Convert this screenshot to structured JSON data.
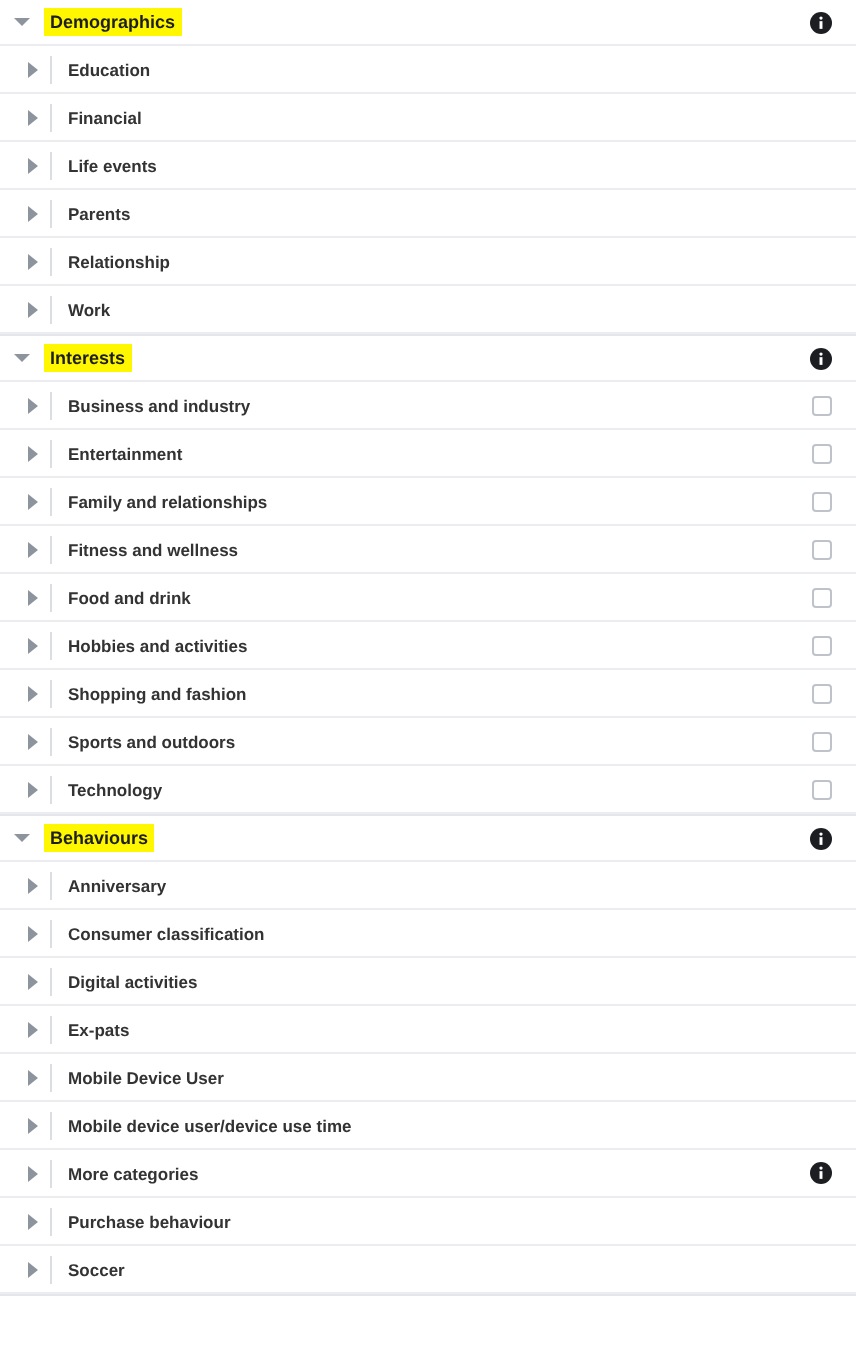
{
  "sections": [
    {
      "title": "Demographics",
      "highlighted": true,
      "items": [
        {
          "label": "Education",
          "kind": "plain"
        },
        {
          "label": "Financial",
          "kind": "plain"
        },
        {
          "label": "Life events",
          "kind": "plain"
        },
        {
          "label": "Parents",
          "kind": "plain"
        },
        {
          "label": "Relationship",
          "kind": "plain"
        },
        {
          "label": "Work",
          "kind": "plain"
        }
      ]
    },
    {
      "title": "Interests",
      "highlighted": true,
      "items": [
        {
          "label": "Business and industry",
          "kind": "checkbox",
          "checked": false
        },
        {
          "label": "Entertainment",
          "kind": "checkbox",
          "checked": false
        },
        {
          "label": "Family and relationships",
          "kind": "checkbox",
          "checked": false
        },
        {
          "label": "Fitness and wellness",
          "kind": "checkbox",
          "checked": false
        },
        {
          "label": "Food and drink",
          "kind": "checkbox",
          "checked": false
        },
        {
          "label": "Hobbies and activities",
          "kind": "checkbox",
          "checked": false
        },
        {
          "label": "Shopping and fashion",
          "kind": "checkbox",
          "checked": false
        },
        {
          "label": "Sports and outdoors",
          "kind": "checkbox",
          "checked": false
        },
        {
          "label": "Technology",
          "kind": "checkbox",
          "checked": false
        }
      ]
    },
    {
      "title": "Behaviours",
      "highlighted": true,
      "items": [
        {
          "label": "Anniversary",
          "kind": "plain"
        },
        {
          "label": "Consumer classification",
          "kind": "plain"
        },
        {
          "label": "Digital activities",
          "kind": "plain"
        },
        {
          "label": "Ex-pats",
          "kind": "plain"
        },
        {
          "label": "Mobile Device User",
          "kind": "plain"
        },
        {
          "label": "Mobile device user/device use time",
          "kind": "plain"
        },
        {
          "label": "More categories",
          "kind": "info"
        },
        {
          "label": "Purchase behaviour",
          "kind": "plain"
        },
        {
          "label": "Soccer",
          "kind": "plain"
        }
      ]
    }
  ]
}
